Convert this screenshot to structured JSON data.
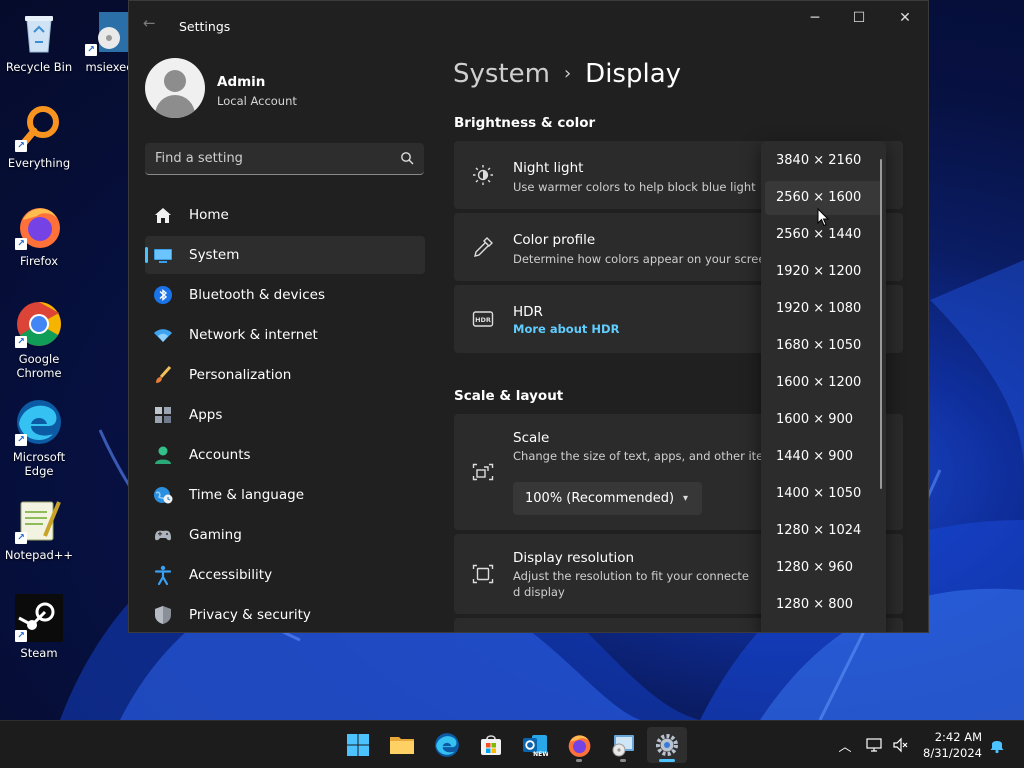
{
  "desktop": {
    "icons": [
      {
        "label": "Recycle Bin"
      },
      {
        "label": "msiexec"
      },
      {
        "label": "Everything"
      },
      {
        "label": "Firefox"
      },
      {
        "label": "Google Chrome"
      },
      {
        "label": "Microsoft Edge"
      },
      {
        "label": "Notepad++"
      },
      {
        "label": "Steam"
      }
    ]
  },
  "window": {
    "title": "Settings",
    "controls": {
      "minimize": "─",
      "maximize": "☐",
      "close": "✕"
    }
  },
  "profile": {
    "name": "Admin",
    "account_type": "Local Account"
  },
  "search": {
    "placeholder": "Find a setting"
  },
  "nav": {
    "items": [
      {
        "label": "Home",
        "icon": "home-icon"
      },
      {
        "label": "System",
        "icon": "system-icon",
        "active": true
      },
      {
        "label": "Bluetooth & devices",
        "icon": "bluetooth-icon"
      },
      {
        "label": "Network & internet",
        "icon": "wifi-icon"
      },
      {
        "label": "Personalization",
        "icon": "brush-icon"
      },
      {
        "label": "Apps",
        "icon": "apps-icon"
      },
      {
        "label": "Accounts",
        "icon": "accounts-icon"
      },
      {
        "label": "Time & language",
        "icon": "globe-icon"
      },
      {
        "label": "Gaming",
        "icon": "gamepad-icon"
      },
      {
        "label": "Accessibility",
        "icon": "accessibility-icon"
      },
      {
        "label": "Privacy & security",
        "icon": "shield-icon"
      }
    ]
  },
  "breadcrumb": {
    "parent": "System",
    "separator": "›",
    "current": "Display"
  },
  "sections": {
    "brightness": "Brightness & color",
    "scale_layout": "Scale & layout"
  },
  "cards": {
    "night_light": {
      "title": "Night light",
      "subtitle": "Use warmer colors to help block blue light"
    },
    "color_profile": {
      "title": "Color profile",
      "subtitle": "Determine how colors appear on your screen"
    },
    "hdr": {
      "title": "HDR",
      "link": "More about HDR"
    },
    "scale": {
      "title": "Scale",
      "subtitle": "Change the size of text, apps, and other items",
      "value": "100% (Recommended)"
    },
    "resolution": {
      "title": "Display resolution",
      "subtitle_line1": "Adjust the resolution to fit your connecte",
      "subtitle_line2": "d display"
    }
  },
  "resolution_options": [
    "3840 × 2160",
    "2560 × 1600",
    "2560 × 1440",
    "1920 × 1200",
    "1920 × 1080",
    "1680 × 1050",
    "1600 × 1200",
    "1600 × 900",
    "1440 × 900",
    "1400 × 1050",
    "1280 × 1024",
    "1280 × 960",
    "1280 × 800"
  ],
  "resolution_hovered_index": 1,
  "taskbar": {
    "apps": [
      "start-icon",
      "file-explorer-icon",
      "edge-icon",
      "store-icon",
      "outlook-icon",
      "firefox-icon",
      "setup-icon",
      "settings-icon"
    ],
    "active_app": "settings-icon",
    "time": "2:42 AM",
    "date": "8/31/2024"
  },
  "colors": {
    "accent": "#4cc2ff",
    "link": "#60cdff",
    "window_bg": "#202020",
    "card_bg": "#2b2b2b"
  }
}
